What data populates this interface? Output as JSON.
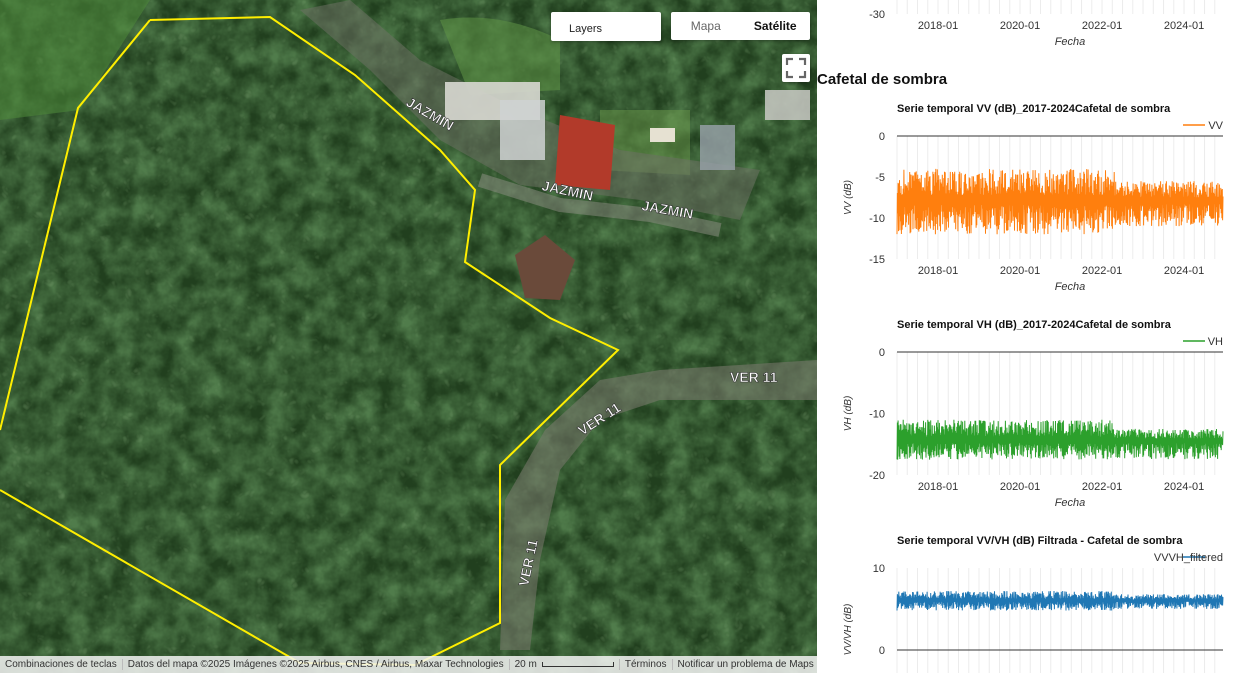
{
  "map": {
    "layers_label": "Layers",
    "map_type_options": [
      "Mapa",
      "Satélite"
    ],
    "selected_map_type": "Satélite",
    "road_labels": [
      "JAZMIN",
      "JAZMIN",
      "JAZMIN",
      "VER 11",
      "VER 11",
      "VER 11"
    ],
    "attribution": {
      "shortcuts": "Combinaciones de teclas",
      "data": "Datos del mapa ©2025 Imágenes ©2025 Airbus, CNES / Airbus, Maxar Technologies",
      "scale": "20 m",
      "terms": "Términos",
      "report": "Notificar un problema de Maps"
    },
    "polygon_color": "#ffee00"
  },
  "panel": {
    "section_title": "Cafetal de sombra"
  },
  "chart_data": [
    {
      "type": "line",
      "title": "",
      "xlabel": "Fecha",
      "ylabel": "",
      "x_ticks": [
        "2018-01",
        "2020-01",
        "2022-01",
        "2024-01"
      ],
      "y_ticks": [
        "-30"
      ],
      "partial": true
    },
    {
      "type": "line",
      "title": "Serie temporal VV (dB)_2017-2024Cafetal de sombra",
      "xlabel": "Fecha",
      "ylabel": "VV (dB)",
      "x_ticks": [
        "2018-01",
        "2020-01",
        "2022-01",
        "2024-01"
      ],
      "y_ticks": [
        "0",
        "-5",
        "-10",
        "-15"
      ],
      "ylim": [
        -15,
        0
      ],
      "xlim": [
        2017.0,
        2024.95
      ],
      "series": [
        {
          "name": "VV",
          "color": "#ff7f0e",
          "x_range": [
            2017.0,
            2024.95
          ],
          "mean": -8.0,
          "low": -12.0,
          "high": -4.0,
          "low_tail": -11.0,
          "high_tail": -5.5
        }
      ]
    },
    {
      "type": "line",
      "title": "Serie temporal VH (dB)_2017-2024Cafetal de sombra",
      "xlabel": "Fecha",
      "ylabel": "VH (dB)",
      "x_ticks": [
        "2018-01",
        "2020-01",
        "2022-01",
        "2024-01"
      ],
      "y_ticks": [
        "0",
        "-10",
        "-20"
      ],
      "ylim": [
        -20,
        0
      ],
      "xlim": [
        2017.0,
        2024.95
      ],
      "series": [
        {
          "name": "VH",
          "color": "#2ca02c",
          "x_range": [
            2017.0,
            2024.95
          ],
          "mean": -14.5,
          "low": -17.5,
          "high": -11.0,
          "low_tail": -17.5,
          "high_tail": -12.5
        }
      ]
    },
    {
      "type": "line",
      "title": "Serie temporal VV/VH (dB) Filtrada - Cafetal de sombra",
      "xlabel": "",
      "ylabel": "VV/VH (dB)",
      "x_ticks": [],
      "y_ticks": [
        "10",
        "0"
      ],
      "ylim": [
        -5,
        10
      ],
      "xlim": [
        2017.0,
        2024.95
      ],
      "partial": true,
      "series": [
        {
          "name": "VVVH_filtered",
          "color": "#1f77b4",
          "x_range": [
            2017.0,
            2024.95
          ],
          "mean": 6.0,
          "low": 4.8,
          "high": 7.2,
          "low_tail": 5.0,
          "high_tail": 6.8
        }
      ]
    }
  ]
}
